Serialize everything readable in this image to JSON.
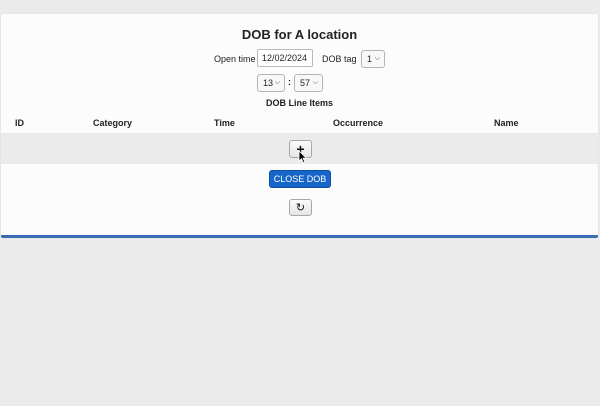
{
  "form": {
    "title": "DOB for A location",
    "open_time_label": "Open time",
    "open_time_value": "12/02/2024",
    "dob_tag_label": "DOB tag",
    "dob_tag_value": "1",
    "hour_value": "13",
    "time_separator": ":",
    "minute_value": "57"
  },
  "table": {
    "title": "DOB Line Items",
    "columns": [
      "ID",
      "Category",
      "Time",
      "Occurrence",
      "Name"
    ]
  },
  "buttons": {
    "add_label": "+",
    "close_label": "CLOSE DOB",
    "refresh_label": "↻"
  },
  "icons": {
    "chevron": "chevron-down-icon",
    "refresh": "refresh-icon",
    "add": "plus-icon"
  },
  "colors": {
    "accent": "#1566c8",
    "panel_border": "#3a6cb4",
    "background": "#ebebeb"
  }
}
